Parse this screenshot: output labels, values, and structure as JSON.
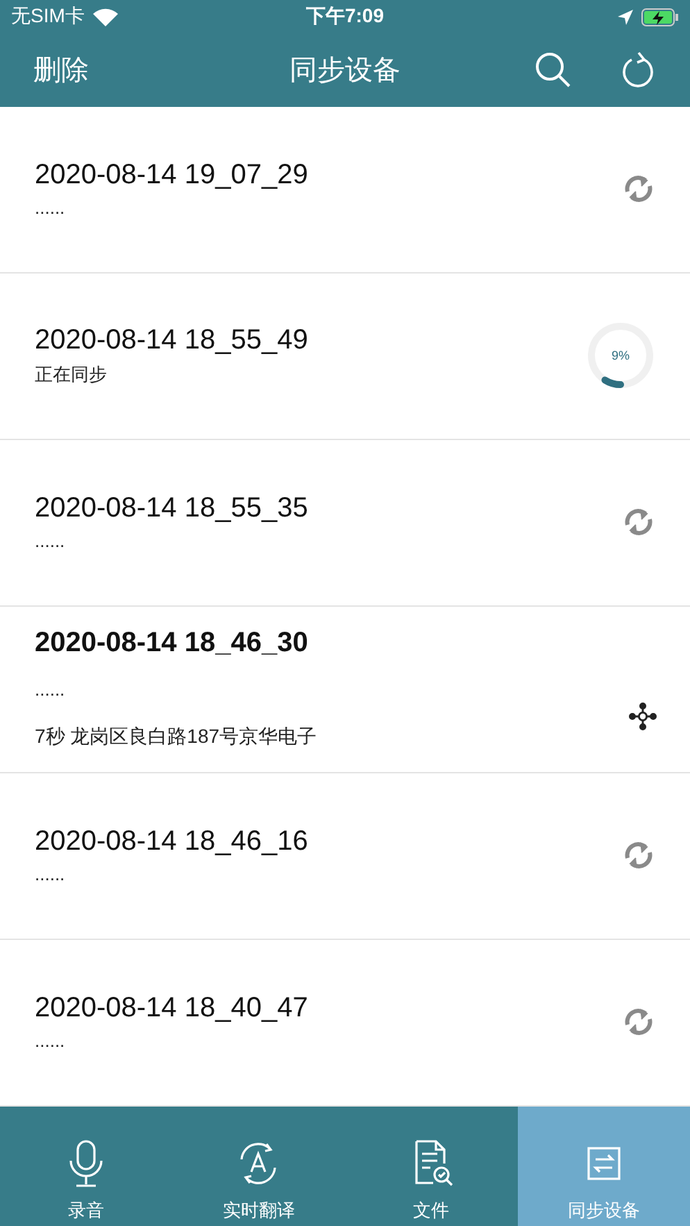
{
  "status_bar": {
    "carrier": "无SIM卡",
    "time": "下午7:09"
  },
  "nav": {
    "left": "删除",
    "title": "同步设备"
  },
  "recordings": [
    {
      "title": "2020-08-14 19_07_29",
      "subtitle": "......",
      "emphasized": false,
      "kind": "sync"
    },
    {
      "title": "2020-08-14 18_55_49",
      "subtitle": "正在同步",
      "emphasized": false,
      "kind": "progress",
      "level": 0.09,
      "reading": "9%"
    },
    {
      "title": "2020-08-14 18_55_35",
      "subtitle": "......",
      "emphasized": false,
      "kind": "sync"
    },
    {
      "title": "2020-08-14 18_46_30",
      "subtitle": "......",
      "detail": "7秒 龙岗区良白路187号京华电子",
      "emphasized": true,
      "kind": "share"
    },
    {
      "title": "2020-08-14 18_46_16",
      "subtitle": "......",
      "emphasized": false,
      "kind": "sync"
    },
    {
      "title": "2020-08-14 18_40_47",
      "subtitle": "......",
      "emphasized": false,
      "kind": "sync"
    }
  ],
  "tabs": [
    {
      "label": "录音",
      "kind": "mic",
      "selected": false
    },
    {
      "label": "实时翻译",
      "kind": "translate",
      "selected": false
    },
    {
      "label": "文件",
      "kind": "file",
      "selected": false
    },
    {
      "label": "同步设备",
      "kind": "sync",
      "selected": true
    }
  ]
}
